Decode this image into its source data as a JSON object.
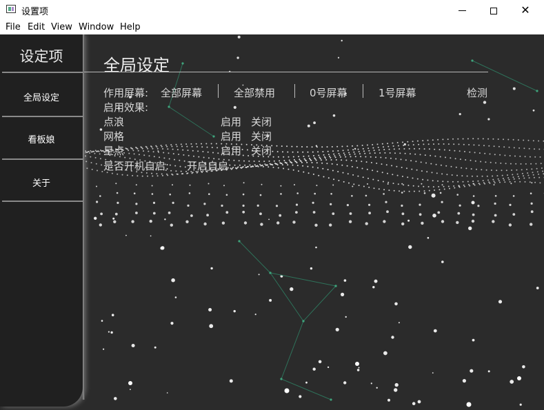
{
  "window": {
    "title": "设置项",
    "minimize_icon": "minimize-icon",
    "maximize_icon": "maximize-icon",
    "close_icon": "close-icon"
  },
  "menu": [
    "File",
    "Edit",
    "View",
    "Window",
    "Help"
  ],
  "sidebar": {
    "title": "设定项",
    "items": [
      {
        "label": "全局设定"
      },
      {
        "label": "看板娘"
      },
      {
        "label": "关于"
      }
    ]
  },
  "main": {
    "title": "全局设定",
    "screen_label": "作用屏幕:",
    "screen_options": [
      "全部屏幕",
      "全部禁用",
      "0号屏幕",
      "1号屏幕"
    ],
    "detect": "检测",
    "effects_label": "启用效果:",
    "effects": [
      {
        "name": "点浪",
        "on": "启用",
        "off": "关闭"
      },
      {
        "name": "网格",
        "on": "启用",
        "off": "关闭"
      },
      {
        "name": "星点",
        "on": "启用",
        "off": "关闭"
      }
    ],
    "autostart_label": "是否开机自启:",
    "autostart_action": "开启自启"
  },
  "colors": {
    "background": "#2b2b2b",
    "sidebar": "#202020",
    "text": "#d8d8d8",
    "constellation": "#2f7a5f"
  }
}
